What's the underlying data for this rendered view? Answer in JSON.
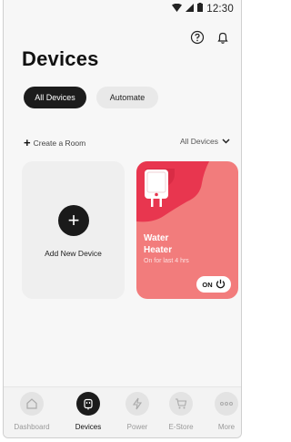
{
  "status_bar": {
    "time": "12:30"
  },
  "header": {
    "title": "Devices"
  },
  "filters": {
    "all_devices": "All Devices",
    "automate": "Automate"
  },
  "actions": {
    "create_room": "Create a Room",
    "filter_selected": "All Devices"
  },
  "add_card": {
    "label": "Add New Device",
    "plus": "+"
  },
  "device": {
    "name": "Water Heater",
    "status": "On for last 4 hrs",
    "toggle_label": "ON"
  },
  "nav": {
    "items": [
      {
        "label": "Dashboard",
        "icon": "home-icon"
      },
      {
        "label": "Devices",
        "icon": "plug-icon"
      },
      {
        "label": "Power",
        "icon": "bolt-icon"
      },
      {
        "label": "E-Store",
        "icon": "cart-icon"
      },
      {
        "label": "More",
        "icon": "more-icon"
      }
    ]
  },
  "colors": {
    "device_card": "#f27c7c",
    "device_blob": "#e8364f",
    "active": "#1c1c1c"
  }
}
